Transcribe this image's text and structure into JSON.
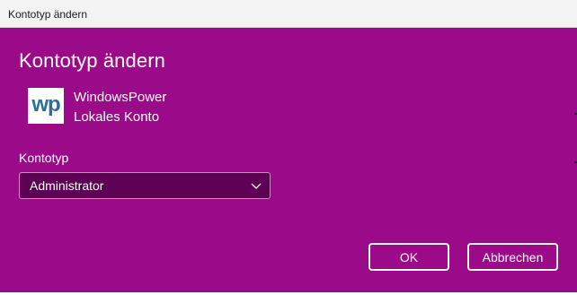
{
  "window": {
    "title": "Kontotyp ändern"
  },
  "dialog": {
    "heading": "Kontotyp ändern",
    "account": {
      "avatar_text": "wp",
      "name": "WindowsPower",
      "type": "Lokales Konto"
    },
    "account_type_label": "Kontotyp",
    "account_type_select": {
      "selected": "Administrator",
      "icon": "chevron-down-icon"
    },
    "buttons": {
      "ok": "OK",
      "cancel": "Abbrechen"
    }
  },
  "colors": {
    "dialog_background": "#9b0a89",
    "select_background": "#5e0054",
    "titlebar_background": "#f3f3f3",
    "avatar_text": "#2c6f9c"
  }
}
